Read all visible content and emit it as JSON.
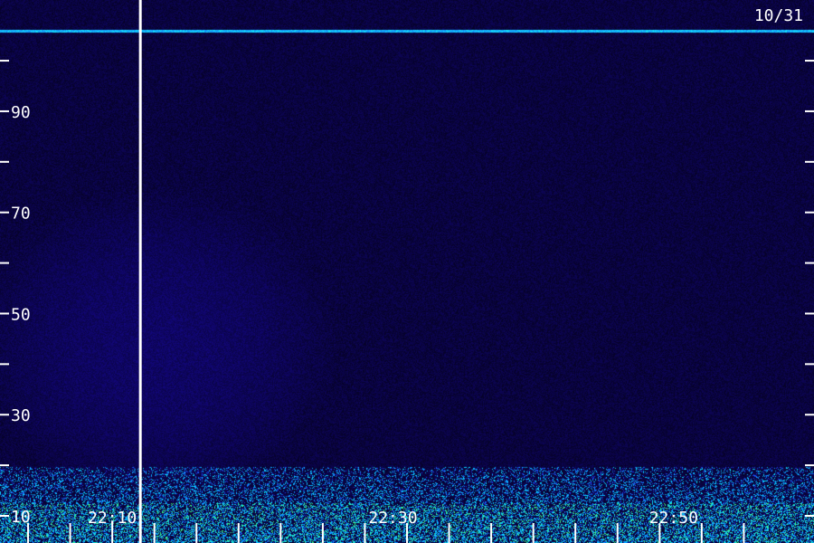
{
  "chart_data": {
    "type": "heatmap",
    "title": "",
    "date_label": "10/31",
    "xlabel": "",
    "ylabel": "",
    "x_ticks": [
      {
        "time": "22:10",
        "label": "22:10"
      },
      {
        "time": "22:30",
        "label": "22:30"
      },
      {
        "time": "22:50",
        "label": "22:50"
      }
    ],
    "x_minor_ticks": [
      "22:04",
      "22:07",
      "22:10",
      "22:13",
      "22:16",
      "22:19",
      "22:22",
      "22:25",
      "22:28",
      "22:31",
      "22:34",
      "22:37",
      "22:40",
      "22:43",
      "22:46",
      "22:49",
      "22:52",
      "22:55"
    ],
    "x_range": [
      "22:02",
      "23:00"
    ],
    "y_range": [
      10,
      112
    ],
    "y_ticks": [
      90,
      70,
      50,
      30,
      10
    ],
    "y_minor_ticks": [
      100,
      80,
      60,
      40,
      20
    ],
    "y_tick_visible_labels": [
      "90",
      "70",
      "50",
      "30",
      "10"
    ],
    "partial_label_left": "10",
    "vertical_marker_time": "22:12",
    "horizontal_line_value": 106,
    "colors": {
      "background": "#1a0a4a",
      "low": "#16063a",
      "mid": "#2a1a9a",
      "high": "#3a5aff",
      "peak": "#00e0ff",
      "bright": "#40ff80",
      "tick": "#ffffff",
      "text": "#ffffff"
    },
    "grid": false
  }
}
